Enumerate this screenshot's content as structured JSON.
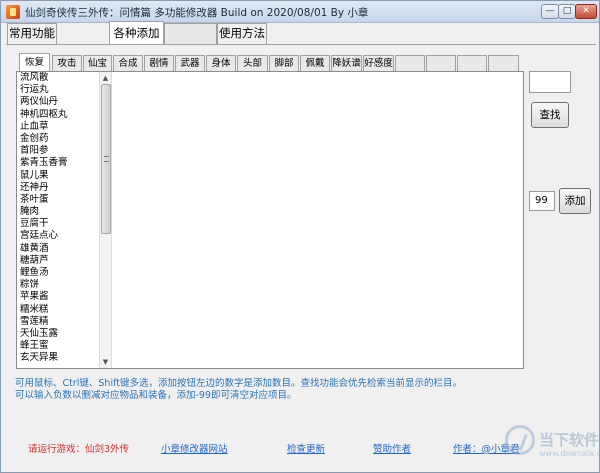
{
  "window": {
    "title": "仙剑奇侠传三外传：问情篇 多功能修改器 Build on 2020/08/01 By 小章",
    "minimize": "—",
    "maximize": "□",
    "close": "✕"
  },
  "main_tabs": [
    {
      "label": "常用功能"
    },
    {
      "label": "各种添加"
    },
    {
      "label": ""
    },
    {
      "label": "使用方法"
    }
  ],
  "sub_tabs": [
    {
      "label": "恢复"
    },
    {
      "label": "攻击"
    },
    {
      "label": "仙宝"
    },
    {
      "label": "合成"
    },
    {
      "label": "剧情"
    },
    {
      "label": "武器"
    },
    {
      "label": "身体"
    },
    {
      "label": "头部"
    },
    {
      "label": "脚部"
    },
    {
      "label": "佩戴"
    },
    {
      "label": "降妖谱"
    },
    {
      "label": "好感度"
    },
    {
      "label": ""
    },
    {
      "label": ""
    },
    {
      "label": ""
    },
    {
      "label": ""
    }
  ],
  "items": [
    "流风散",
    "行运丸",
    "两仪仙丹",
    "神机四枢丸",
    "止血草",
    "金创药",
    "首阳参",
    "紫青玉香膏",
    "鼠儿果",
    "还神丹",
    "茶叶蛋",
    "腌肉",
    "豆腐干",
    "宫廷点心",
    "雄黄酒",
    "糖葫芦",
    "鲤鱼汤",
    "粽饼",
    "苹果酱",
    "糯米糕",
    "雪莲精",
    "天仙玉露",
    "蜂王蜜",
    "玄天异果"
  ],
  "controls": {
    "search_value": "",
    "find_label": "查找",
    "quantity": "99",
    "add_label": "添加"
  },
  "hints": [
    "可用鼠标、Ctrl键、Shift键多选，添加按钮左边的数字是添加数目。查找功能会优先检索当前显示的栏目。",
    "可以输入负数以删减对应物品和装备，添加-99即可清空对应项目。"
  ],
  "footer": {
    "run_game": "请运行游戏：仙剑3外传",
    "site_link": "小章修改器网站",
    "update_link": "检查更新",
    "sponsor_link": "赞助作者",
    "author_link": "作者：@小章君"
  },
  "watermark": {
    "name": "当下软件园",
    "url": "www.downxia.com"
  }
}
